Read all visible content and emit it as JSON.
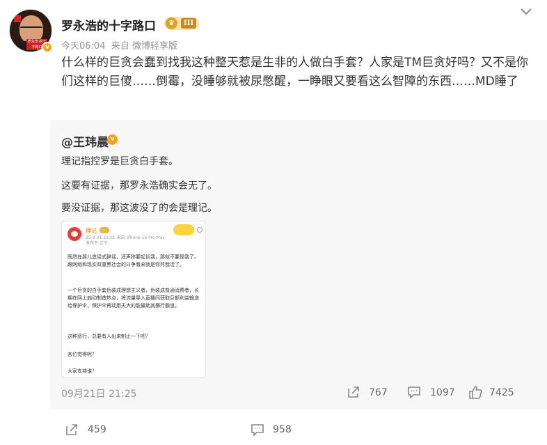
{
  "post": {
    "username": "罗永浩的十字路口",
    "level": "III",
    "time": "今天06:04",
    "source_prefix": "来自",
    "source": "微博轻享版",
    "text": "什么样的巨贪会蠢到￼找我这种整天惹是生非的人做白手套？￼人家是TM巨贪好吗？又不是你们这样的巨傻……倒霉，没睡够就被尿憋醒，一睁眼又要看这么智障的东西……MD睡了",
    "avatar_caption": "罗永浩 的十字路口"
  },
  "repost": {
    "username": "@王玮晨",
    "lines": [
      "理记指控罗是巨贪白手套。",
      "这要有证据，那罗永浩确实会无了。",
      "要没证据，那这波没了的会是理记。"
    ],
    "screenshot": {
      "name": "理记",
      "meta_line1": "25-9-21 21:01 来自 iPhone 16 Pro Max",
      "meta_line2": "发布于 辽宁",
      "paragraphs": [
        "既然在那儿造谣式辟谣，还声称要起诉我，那就不要怪我了。跟网络和现实双重黑社会的斗争看来就是你死我活了。",
        "一个巨贪的白手套伪装成理想主义者，伪装成普通消费者，长期在网上煽动制造热点，将流量导入直播间获取巨额利益输送给保护伞，保护伞再动用天大的能量助其横行霸道。",
        "这种恶行，总要有人出来制止一下吧？",
        "各位觉得呢？",
        "大家支持谁？"
      ]
    },
    "date": "09月21日 21:25",
    "reposts": "767",
    "comments": "1097",
    "likes": "7425"
  },
  "footer": {
    "reposts": "459",
    "comments": "958"
  },
  "colors": {
    "muted": "#939393",
    "box": "#f7f7f7",
    "verify": "#f4a21a"
  }
}
